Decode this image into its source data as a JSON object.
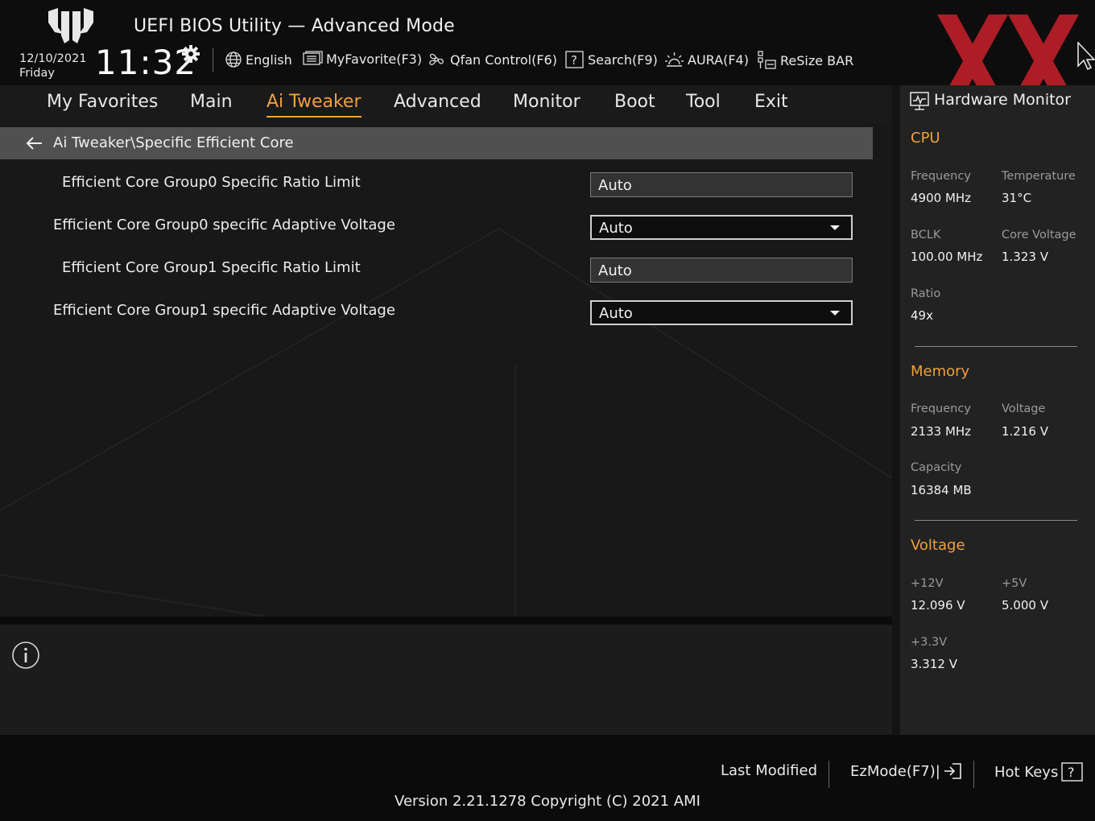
{
  "header": {
    "title": "UEFI BIOS Utility — Advanced Mode",
    "date": "12/10/2021",
    "weekday": "Friday",
    "time": "11:32",
    "tools": [
      {
        "label": "English",
        "icon": "globe-icon"
      },
      {
        "label": "MyFavorite(F3)",
        "icon": "favorite-list-icon"
      },
      {
        "label": "Qfan Control(F6)",
        "icon": "fan-icon"
      },
      {
        "label": "Search(F9)",
        "icon": "search-help-icon"
      },
      {
        "label": "AURA(F4)",
        "icon": "aura-icon"
      },
      {
        "label": "ReSize BAR",
        "icon": "resize-bar-icon"
      }
    ]
  },
  "nav": {
    "tabs": [
      "My Favorites",
      "Main",
      "Ai Tweaker",
      "Advanced",
      "Monitor",
      "Boot",
      "Tool",
      "Exit"
    ],
    "active": "Ai Tweaker"
  },
  "breadcrumb": "Ai Tweaker\\Specific Efficient Core",
  "settings": [
    {
      "label": "Efficient Core Group0 Specific Ratio Limit",
      "value": "Auto",
      "kind": "text"
    },
    {
      "label": "Efficient Core Group0 specific Adaptive Voltage",
      "value": "Auto",
      "kind": "dropdown"
    },
    {
      "label": "Efficient Core Group1 Specific Ratio Limit",
      "value": "Auto",
      "kind": "text"
    },
    {
      "label": "Efficient Core Group1 specific Adaptive Voltage",
      "value": "Auto",
      "kind": "dropdown"
    }
  ],
  "hw_monitor": {
    "title": "Hardware Monitor",
    "cpu": {
      "heading": "CPU",
      "frequency_label": "Frequency",
      "frequency": "4900 MHz",
      "temperature_label": "Temperature",
      "temperature": "31°C",
      "bclk_label": "BCLK",
      "bclk": "100.00 MHz",
      "core_voltage_label": "Core Voltage",
      "core_voltage": "1.323 V",
      "ratio_label": "Ratio",
      "ratio": "49x"
    },
    "memory": {
      "heading": "Memory",
      "frequency_label": "Frequency",
      "frequency": "2133 MHz",
      "voltage_label": "Voltage",
      "voltage": "1.216 V",
      "capacity_label": "Capacity",
      "capacity": "16384 MB"
    },
    "voltage": {
      "heading": "Voltage",
      "v12_label": "+12V",
      "v12": "12.096 V",
      "v5_label": "+5V",
      "v5": "5.000 V",
      "v33_label": "+3.3V",
      "v33": "3.312 V"
    }
  },
  "footer": {
    "last_modified": "Last Modified",
    "ezmode": "EzMode(F7)|",
    "hotkeys": "Hot Keys",
    "version": "Version 2.21.1278 Copyright (C) 2021 AMI"
  },
  "colors": {
    "accent": "#f0a03c",
    "watermark": "#c8202a"
  }
}
